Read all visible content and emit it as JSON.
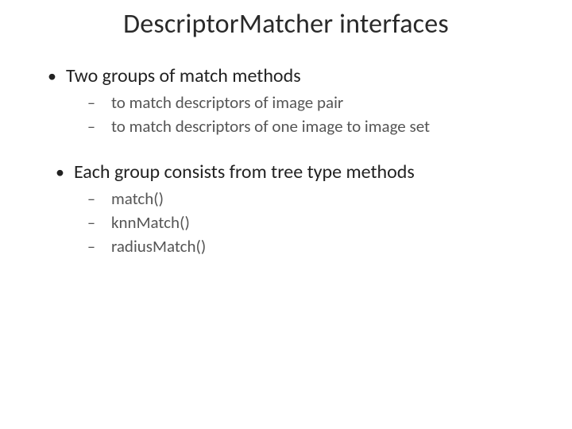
{
  "title": "DescriptorMatcher interfaces",
  "group1": {
    "heading": "Two groups of match methods",
    "items": [
      "to match descriptors of image pair",
      "to match descriptors of one image to image set"
    ]
  },
  "group2": {
    "heading": "Each group consists from tree type methods",
    "items": [
      "match()",
      "knnMatch()",
      "radiusMatch()"
    ]
  }
}
